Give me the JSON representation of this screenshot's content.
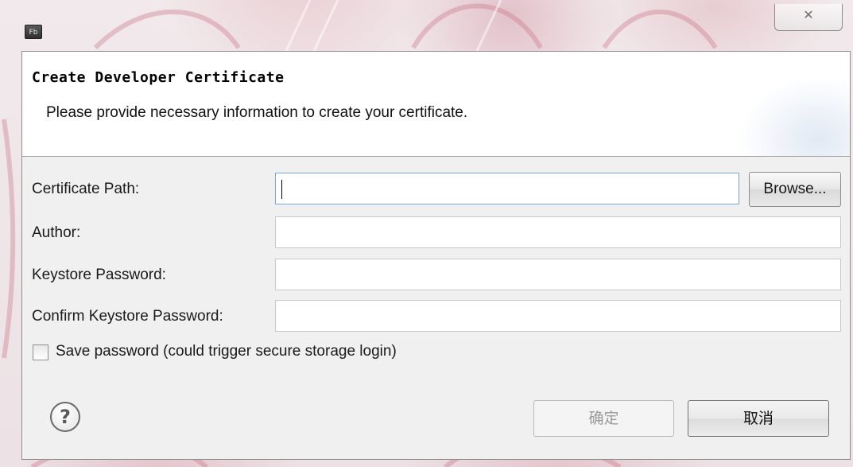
{
  "window": {
    "app_icon_text": "Fb",
    "close_glyph": "✕"
  },
  "header": {
    "title": "Create Developer Certificate",
    "description": "Please provide necessary information to create your certificate."
  },
  "form": {
    "certificate_path": {
      "label": "Certificate Path:",
      "value": ""
    },
    "browse_label": "Browse...",
    "author": {
      "label": "Author:",
      "value": ""
    },
    "keystore_password": {
      "label": "Keystore Password:",
      "value": ""
    },
    "confirm_keystore_password": {
      "label": "Confirm Keystore Password:",
      "value": ""
    },
    "save_password": {
      "label": "Save password (could trigger secure storage login)",
      "checked": false
    }
  },
  "footer": {
    "help_glyph": "?",
    "ok_label": "确定",
    "cancel_label": "取消"
  },
  "colors": {
    "frame_tint": "#efe7e9",
    "header_bg": "#ffffff",
    "dialog_bg": "#f0f0f0",
    "focus_border": "#7aa7d6"
  },
  "icons": [
    "app-icon",
    "close-icon",
    "help-icon",
    "checkbox-icon"
  ]
}
